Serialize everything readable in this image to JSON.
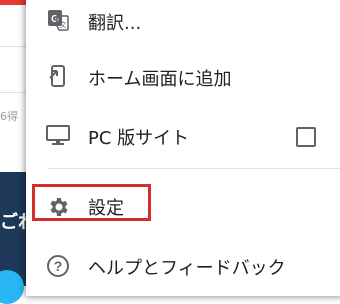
{
  "background": {
    "partial_text": "6得",
    "partial_banner_text": "ごわ"
  },
  "menu": {
    "items": [
      {
        "id": "translate",
        "label": "翻訳...",
        "icon": "translate-icon"
      },
      {
        "id": "add_to_home",
        "label": "ホーム画面に追加",
        "icon": "add-to-home-icon"
      },
      {
        "id": "desktop_site",
        "label": "PC 版サイト",
        "icon": "desktop-icon",
        "checked": false
      },
      {
        "id": "settings",
        "label": "設定",
        "icon": "gear-icon"
      },
      {
        "id": "help",
        "label": "ヘルプとフィードバック",
        "icon": "help-icon"
      }
    ]
  },
  "colors": {
    "highlight": "#d32f2f",
    "icon": "#5f6368"
  }
}
